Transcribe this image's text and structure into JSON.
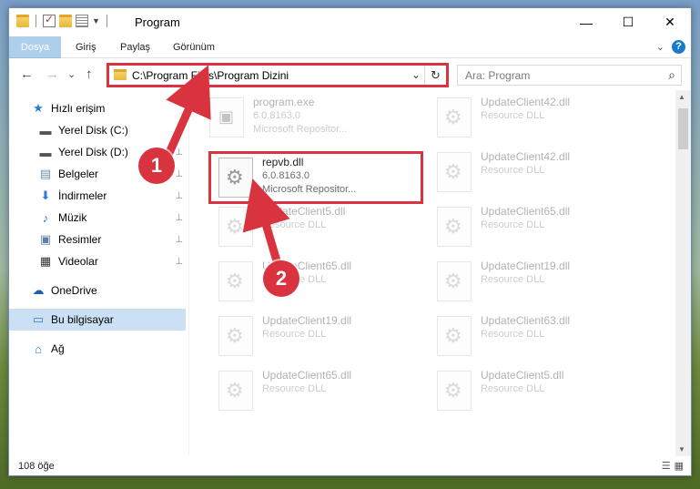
{
  "window": {
    "title": "Program"
  },
  "window_controls": {
    "minimize": "—",
    "maximize": "☐",
    "close": "✕"
  },
  "ribbon": {
    "tabs": [
      "Dosya",
      "Giriş",
      "Paylaş",
      "Görünüm"
    ],
    "expand_icon": "chevron-down-icon",
    "help": "?"
  },
  "nav": {
    "back": "←",
    "forward": "→",
    "recent": "⌄",
    "up": "↑",
    "address": "C:\\Program Files\\Program Dizini",
    "address_chevron": "⌄",
    "refresh": "↻",
    "search_placeholder": "Ara: Program",
    "search_icon": "⌕"
  },
  "sidebar": {
    "items": [
      {
        "label": "Hızlı erişim",
        "icon": "★",
        "color": "#2b7cd3"
      },
      {
        "label": "Yerel Disk (C:)",
        "icon": "▬",
        "color": "#555",
        "pinned": true
      },
      {
        "label": "Yerel Disk (D:)",
        "icon": "▬",
        "color": "#555",
        "pinned": true
      },
      {
        "label": "Belgeler",
        "icon": "▤",
        "color": "#6b8fb6",
        "pinned": true
      },
      {
        "label": "İndirmeler",
        "icon": "⬇",
        "color": "#2b7cd3",
        "pinned": true
      },
      {
        "label": "Müzik",
        "icon": "♪",
        "color": "#2b7cd3",
        "pinned": true
      },
      {
        "label": "Resimler",
        "icon": "▣",
        "color": "#5f7fa8",
        "pinned": true
      },
      {
        "label": "Videolar",
        "icon": "▦",
        "color": "#333",
        "pinned": true
      },
      {
        "label": "OneDrive",
        "icon": "☁",
        "color": "#1e5fb4"
      },
      {
        "label": "Bu bilgisayar",
        "icon": "▭",
        "color": "#2b7cd3",
        "selected": true
      },
      {
        "label": "Ağ",
        "icon": "⌂",
        "color": "#2b7cd3"
      }
    ],
    "pin_icon": "⊥"
  },
  "files": [
    {
      "name": "program.exe",
      "line2": "6.0.8163.0",
      "line3": "Microsoft Repositor...",
      "type": "exe"
    },
    {
      "name": "UpdateClient42.dll",
      "line2": "Resource DLL",
      "type": "dll"
    },
    {
      "name": "repvb.dll",
      "line2": "6.0.8163.0",
      "line3": "Microsoft Repositor...",
      "type": "dll",
      "focus": true
    },
    {
      "name": "UpdateClient42.dll",
      "line2": "Resource DLL",
      "type": "dll"
    },
    {
      "name": "UpdateClient5.dll",
      "line2": "Resource DLL",
      "type": "dll"
    },
    {
      "name": "UpdateClient65.dll",
      "line2": "Resource DLL",
      "type": "dll"
    },
    {
      "name": "UpdateClient65.dll",
      "line2": "Resource DLL",
      "type": "dll"
    },
    {
      "name": "UpdateClient19.dll",
      "line2": "Resource DLL",
      "type": "dll"
    },
    {
      "name": "UpdateClient19.dll",
      "line2": "Resource DLL",
      "type": "dll"
    },
    {
      "name": "UpdateClient63.dll",
      "line2": "Resource DLL",
      "type": "dll"
    },
    {
      "name": "UpdateClient65.dll",
      "line2": "Resource DLL",
      "type": "dll"
    },
    {
      "name": "UpdateClient5.dll",
      "line2": "Resource DLL",
      "type": "dll"
    }
  ],
  "status": {
    "count": "108 öğe"
  },
  "callouts": {
    "one": "1",
    "two": "2"
  },
  "colors": {
    "accent": "#1979ca",
    "highlight": "#d9333f"
  }
}
